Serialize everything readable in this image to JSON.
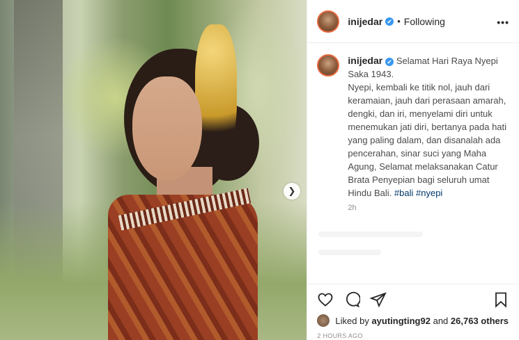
{
  "post": {
    "username": "inijedar",
    "verified_badge": "✔",
    "dot": "•",
    "follow_status": "Following",
    "more_icon": "•••",
    "caption_parts": {
      "first_line": "Selamat Hari Raya Nyepi Saka 1943.",
      "body": "Nyepi, kembali ke titik nol, jauh dari keramaian, jauh dari perasaan amarah, dengki, dan iri, menyelami diri untuk menemukan jati diri, bertanya pada hati yang paling dalam, dan disanalah ada pencerahan, sinar suci yang Maha Agung, Selamat melaksanakan Catur Brata Penyepian bagi seluruh umat Hindu Bali.",
      "hashtag1": "#bali",
      "hashtag2": "#nyepi"
    },
    "caption_time": "2h",
    "liked_by_prefix": "Liked by",
    "liked_by_user": "ayutingting92",
    "liked_by_and": "and",
    "liked_by_others": "26,763 others",
    "posted_ago": "2 HOURS AGO"
  },
  "icons": {
    "next": "chevron-right-icon",
    "like": "heart-icon",
    "comment": "comment-icon",
    "share": "paper-plane-icon",
    "save": "bookmark-icon"
  },
  "colors": {
    "verified": "#3897f0",
    "hashtag": "#00376b",
    "muted": "#8e8e8e"
  }
}
